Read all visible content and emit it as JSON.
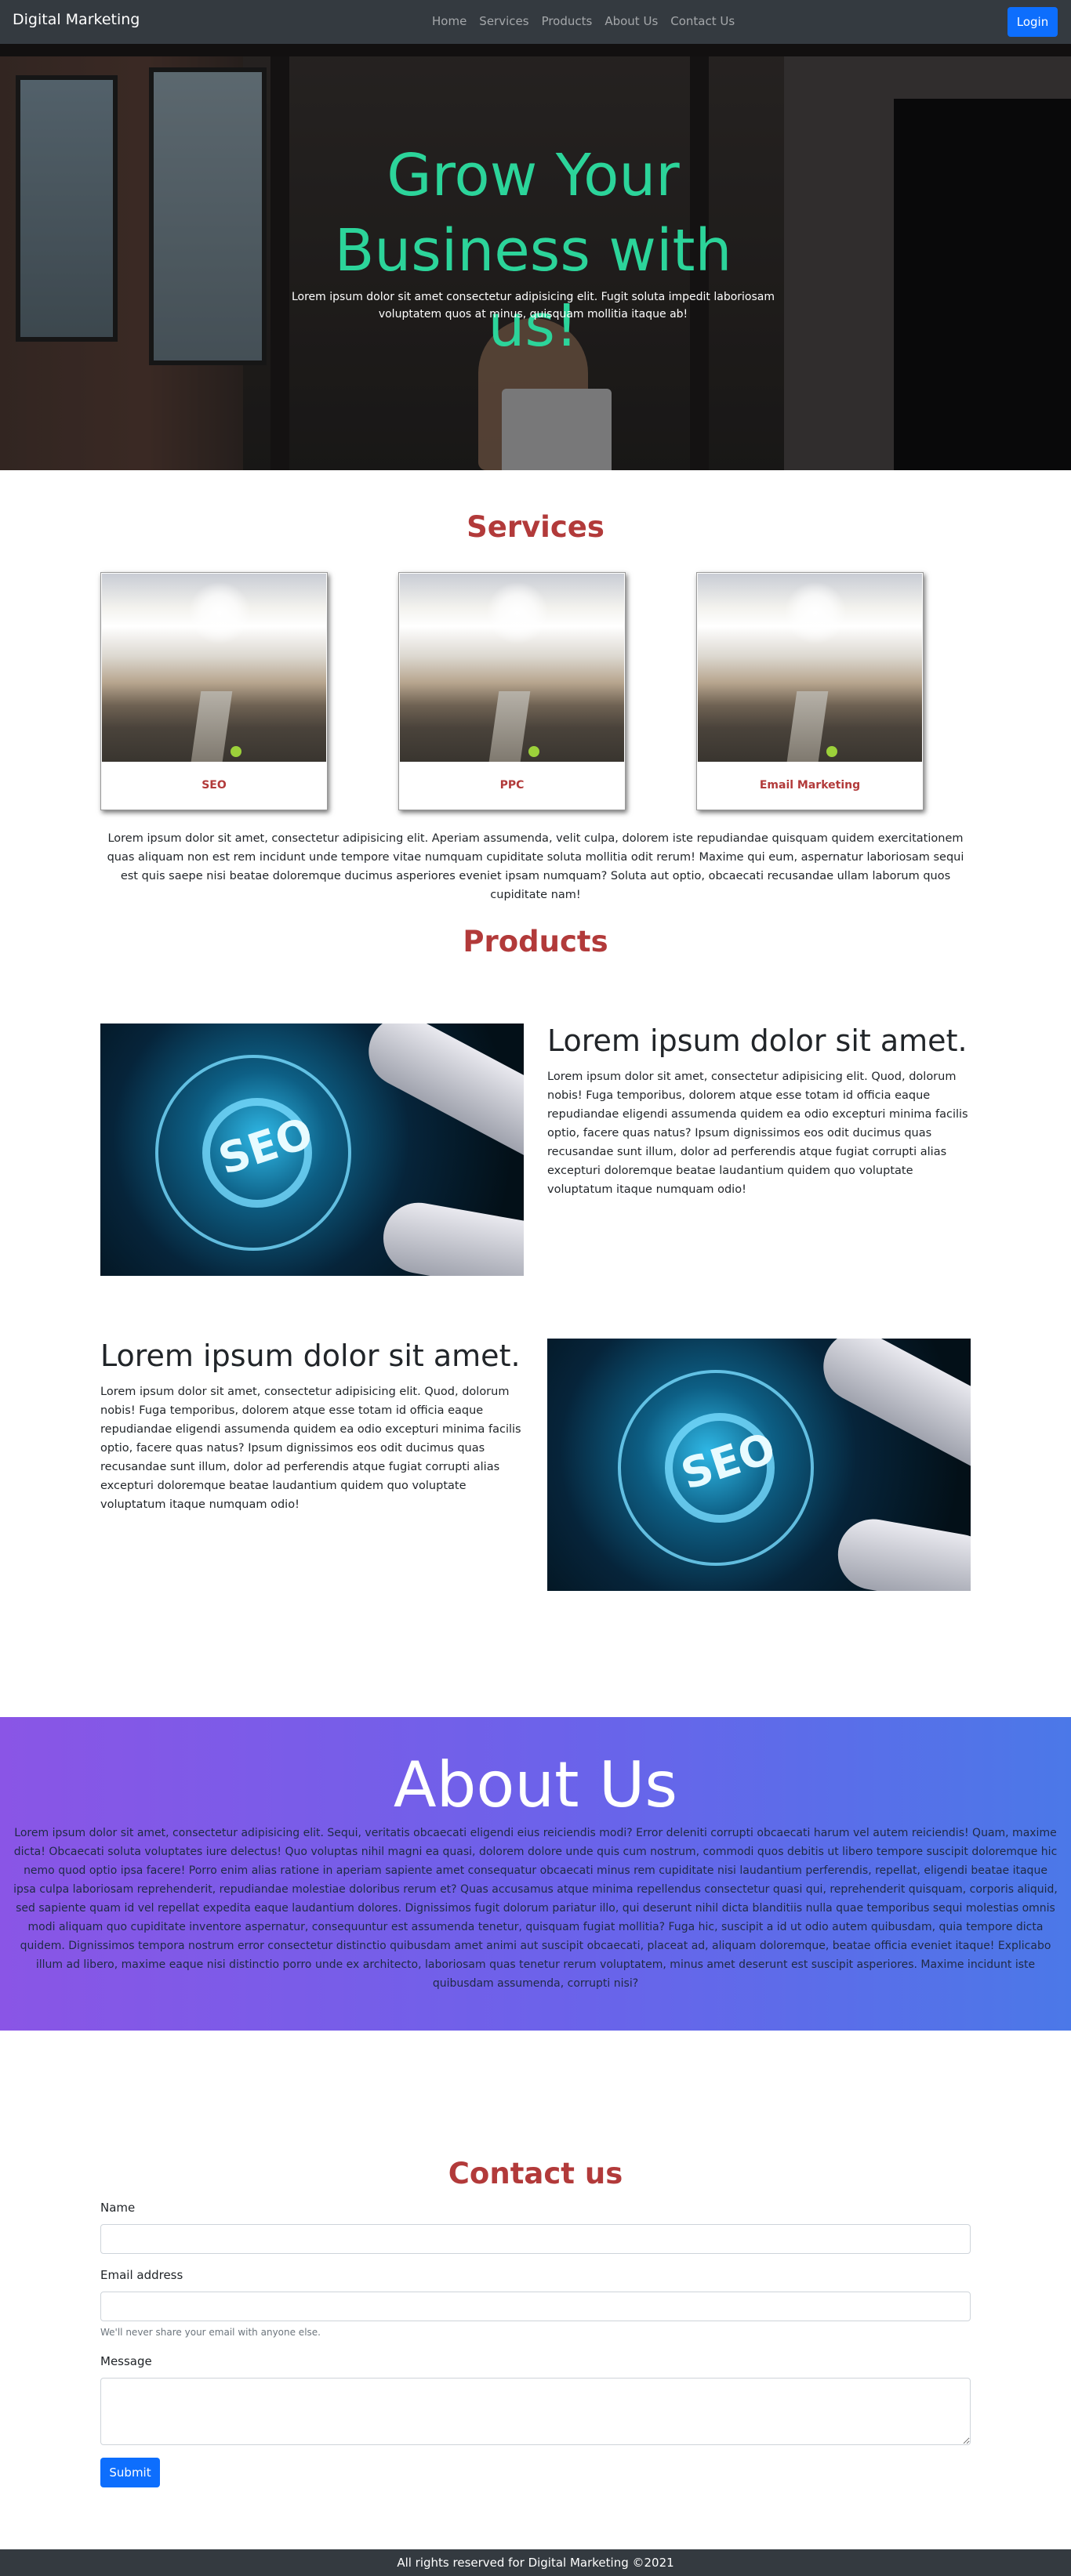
{
  "navbar": {
    "brand": "Digital Marketing",
    "links": [
      "Home",
      "Services",
      "Products",
      "About Us",
      "Contact Us"
    ],
    "login_label": "Login"
  },
  "hero": {
    "title": "Grow Your Business with us!",
    "subtitle": "Lorem ipsum dolor sit amet consectetur adipisicing elit. Fugit soluta impedit laboriosam voluptatem quos at minus, quisquam mollitia itaque ab!"
  },
  "services": {
    "title": "Services",
    "cards": [
      "SEO",
      "PPC",
      "Email Marketing"
    ],
    "text": "Lorem ipsum dolor sit amet, consectetur adipisicing elit. Aperiam assumenda, velit culpa, dolorem iste repudiandae quisquam quidem exercitationem quas aliquam non est rem incidunt unde tempore vitae numquam cupiditate soluta mollitia odit rerum! Maxime qui eum, aspernatur laboriosam sequi est quis saepe nisi beatae doloremque ducimus asperiores eveniet ipsam numquam? Soluta aut optio, obcaecati recusandae ullam laborum quos cupiditate nam!"
  },
  "products": {
    "title": "Products",
    "items": [
      {
        "heading": "Lorem ipsum dolor sit amet.",
        "text": "Lorem ipsum dolor sit amet, consectetur adipisicing elit. Quod, dolorum nobis! Fuga temporibus, dolorem atque esse totam id officia eaque repudiandae eligendi assumenda quidem ea odio excepturi minima facilis optio, facere quas natus? Ipsum dignissimos eos odit ducimus quas recusandae sunt illum, dolor ad perferendis atque fugiat corrupti alias excepturi doloremque beatae laudantium quidem quo voluptate voluptatum itaque numquam odio!",
        "image_text": "SEO"
      },
      {
        "heading": "Lorem ipsum dolor sit amet.",
        "text": "Lorem ipsum dolor sit amet, consectetur adipisicing elit. Quod, dolorum nobis! Fuga temporibus, dolorem atque esse totam id officia eaque repudiandae eligendi assumenda quidem ea odio excepturi minima facilis optio, facere quas natus? Ipsum dignissimos eos odit ducimus quas recusandae sunt illum, dolor ad perferendis atque fugiat corrupti alias excepturi doloremque beatae laudantium quidem quo voluptate voluptatum itaque numquam odio!",
        "image_text": "SEO"
      }
    ]
  },
  "about": {
    "title": "About Us",
    "text": "Lorem ipsum dolor sit amet, consectetur adipisicing elit. Sequi, veritatis obcaecati eligendi eius reiciendis modi? Error deleniti corrupti obcaecati harum vel autem reiciendis! Quam, maxime dicta! Obcaecati soluta voluptates iure delectus! Quo voluptas nihil magni ea quasi, dolorem dolore unde quis cum nostrum, commodi quos debitis ut libero tempore suscipit doloremque hic nemo quod optio ipsa facere! Porro enim alias ratione in aperiam sapiente amet consequatur obcaecati minus rem cupiditate nisi laudantium perferendis, repellat, eligendi beatae itaque ipsa culpa laboriosam reprehenderit, repudiandae molestiae doloribus rerum et? Quas accusamus atque minima repellendus consectetur quasi qui, reprehenderit quisquam, corporis aliquid, sed sapiente quam id vel repellat expedita eaque laudantium dolores. Dignissimos fugit dolorum pariatur illo, qui deserunt nihil dicta blanditiis nulla quae temporibus sequi molestias omnis modi aliquam quo cupiditate inventore aspernatur, consequuntur est assumenda tenetur, quisquam fugiat mollitia? Fuga hic, suscipit a id ut odio autem quibusdam, quia tempore dicta quidem. Dignissimos tempora nostrum error consectetur distinctio quibusdam amet animi aut suscipit obcaecati, placeat ad, aliquam doloremque, beatae officia eveniet itaque! Explicabo illum ad libero, maxime eaque nisi distinctio porro unde ex architecto, laboriosam quas tenetur rerum voluptatem, minus amet deserunt est suscipit asperiores. Maxime incidunt iste quibusdam assumenda, corrupti nisi?"
  },
  "contact": {
    "title": "Contact us",
    "name_label": "Name",
    "name_value": "",
    "email_label": "Email address",
    "email_value": "",
    "email_help": "We'll never share your email with anyone else.",
    "message_label": "Message",
    "message_value": "",
    "submit_label": "Submit"
  },
  "footer": {
    "text": "All rights reserved for Digital Marketing ©2021"
  },
  "colors": {
    "navbar_bg": "#343a40",
    "primary_button": "#0d6efd",
    "hero_title": "#2cd49a",
    "section_title": "#b23a3a",
    "about_gradient_start": "#8a55e6",
    "about_gradient_end": "#4b78e8"
  }
}
